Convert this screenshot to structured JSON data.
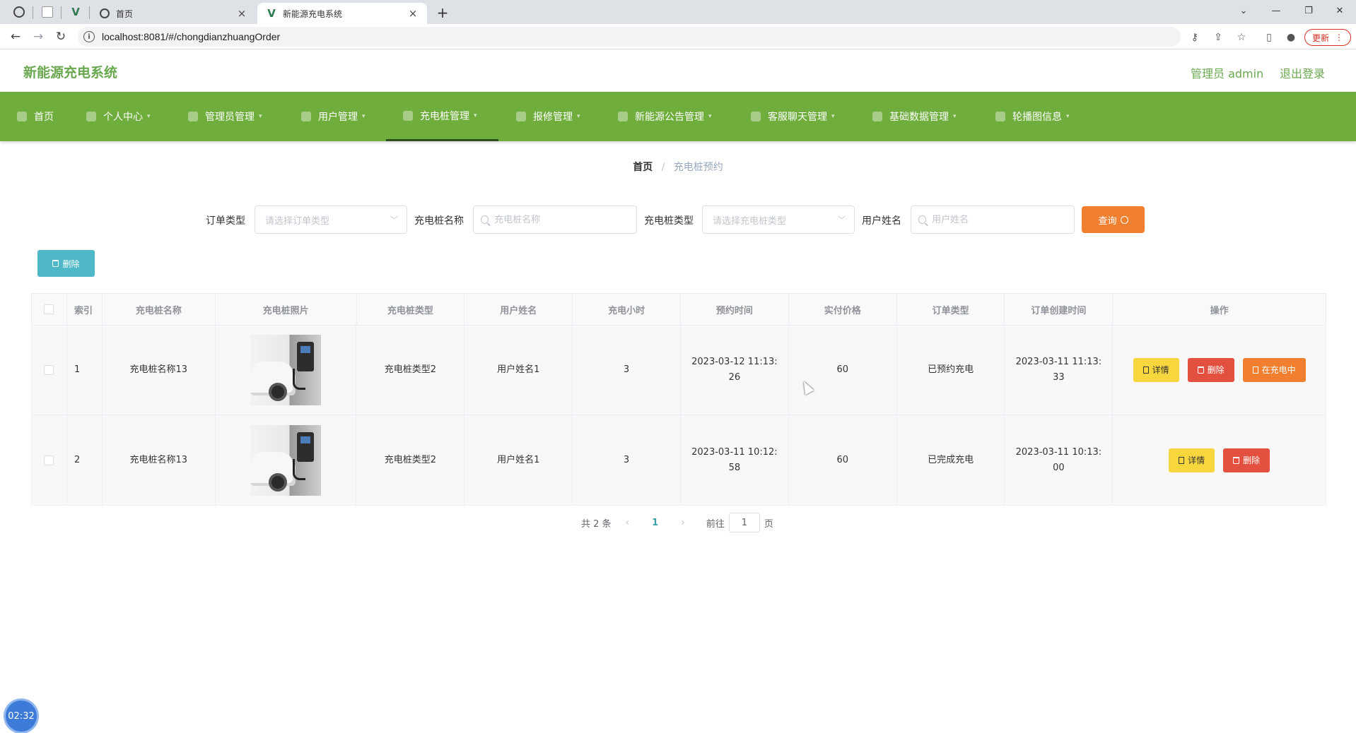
{
  "browser": {
    "tabs": [
      {
        "title": "",
        "favicon": "globe-icon"
      },
      {
        "title": "",
        "favicon": "blank-page-icon"
      },
      {
        "title": "",
        "favicon": "vue-icon"
      },
      {
        "title": "首页",
        "favicon": "globe-icon"
      },
      {
        "title": "新能源充电系统",
        "favicon": "vue-icon",
        "active": true
      }
    ],
    "new_tab": "+",
    "url": "localhost:8081/#/chongdianzhuangOrder",
    "update_label": "更新"
  },
  "header": {
    "title": "新能源充电系统",
    "user": "管理员 admin",
    "logout": "退出登录",
    "accent_color": "#6aa84f"
  },
  "nav": {
    "bg_color": "#6fae3c",
    "items": [
      {
        "label": "首页",
        "icon": "home-icon"
      },
      {
        "label": "个人中心",
        "icon": "user-icon"
      },
      {
        "label": "管理员管理",
        "icon": "admin-icon"
      },
      {
        "label": "用户管理",
        "icon": "users-icon"
      },
      {
        "label": "充电桩管理",
        "icon": "charger-icon",
        "active": true
      },
      {
        "label": "报修管理",
        "icon": "wrench-icon"
      },
      {
        "label": "新能源公告管理",
        "icon": "notice-icon"
      },
      {
        "label": "客服聊天管理",
        "icon": "chat-icon"
      },
      {
        "label": "基础数据管理",
        "icon": "data-icon"
      },
      {
        "label": "轮播图信息",
        "icon": "image-icon"
      }
    ]
  },
  "breadcrumb": {
    "home": "首页",
    "separator": "/",
    "current": "充电桩预约"
  },
  "search": {
    "order_type_label": "订单类型",
    "order_type_placeholder": "请选择订单类型",
    "charger_name_label": "充电桩名称",
    "charger_name_placeholder": "充电桩名称",
    "charger_type_label": "充电桩类型",
    "charger_type_placeholder": "请选择充电桩类型",
    "user_name_label": "用户姓名",
    "user_name_placeholder": "用户姓名",
    "query_label": "查询"
  },
  "bulk_delete_label": "删除",
  "table": {
    "headers": [
      "索引",
      "充电桩名称",
      "充电桩照片",
      "充电桩类型",
      "用户姓名",
      "充电小时",
      "预约时间",
      "实付价格",
      "订单类型",
      "订单创建时间",
      "操作"
    ],
    "rows": [
      {
        "index": "1",
        "name": "充电桩名称13",
        "type": "充电桩类型2",
        "user": "用户姓名1",
        "hours": "3",
        "reserve_time": "2023-03-12 11:13:26",
        "price": "60",
        "order_type": "已预约充电",
        "created": "2023-03-11 11:13:33",
        "actions": [
          "详情",
          "删除",
          "在充电中"
        ]
      },
      {
        "index": "2",
        "name": "充电桩名称13",
        "type": "充电桩类型2",
        "user": "用户姓名1",
        "hours": "3",
        "reserve_time": "2023-03-11 10:12:58",
        "price": "60",
        "order_type": "已完成充电",
        "created": "2023-03-11 10:13:00",
        "actions": [
          "详情",
          "删除"
        ]
      }
    ]
  },
  "pagination": {
    "total": "共 2 条",
    "current_page": "1",
    "goto_label": "前往",
    "goto_value": "1",
    "page_suffix": "页"
  },
  "clock_badge": "02:32"
}
